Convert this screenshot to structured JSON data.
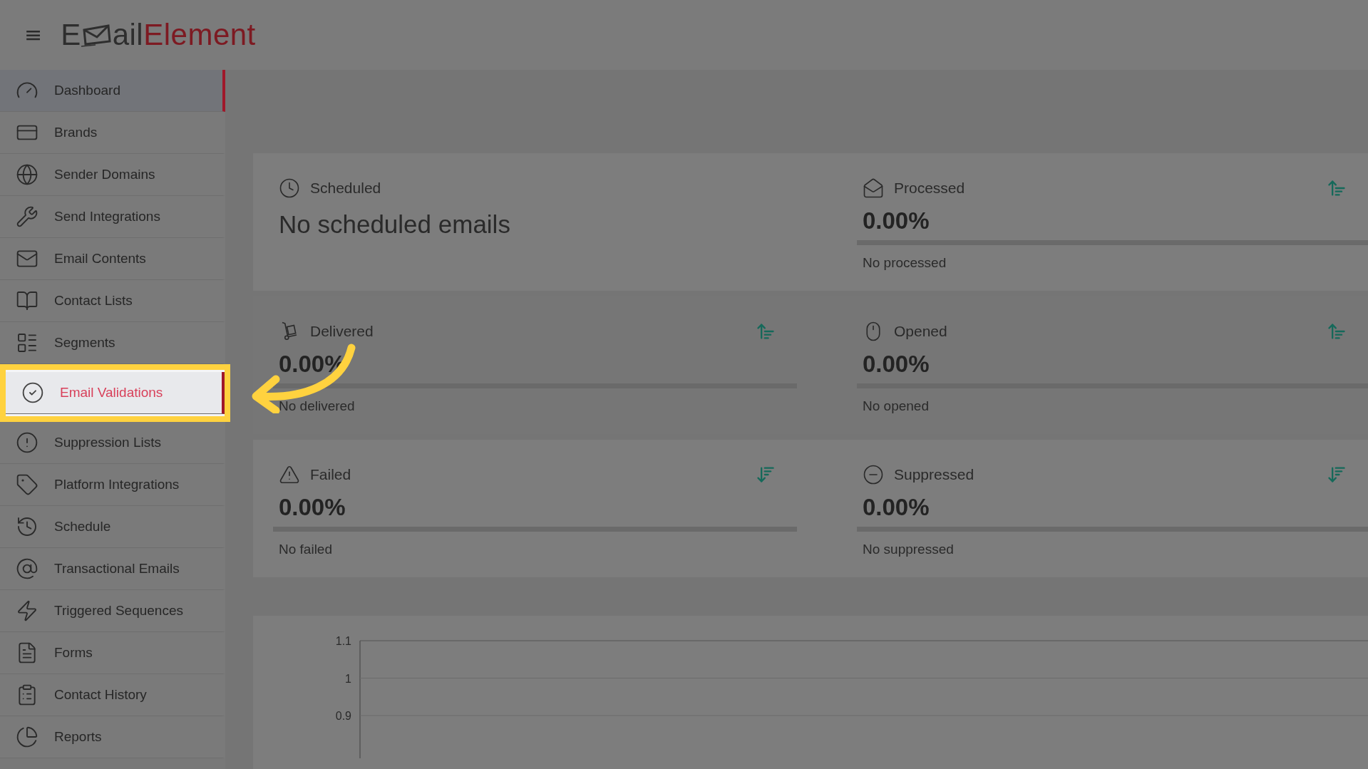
{
  "header": {
    "menu_icon": "≡",
    "logo": {
      "start": "E",
      "middle": "ail",
      "accent": "Element"
    }
  },
  "sidebar": {
    "items": [
      {
        "label": "Dashboard",
        "selected": true,
        "highlighted": false
      },
      {
        "label": "Brands",
        "selected": false,
        "highlighted": false
      },
      {
        "label": "Sender Domains",
        "selected": false,
        "highlighted": false
      },
      {
        "label": "Send Integrations",
        "selected": false,
        "highlighted": false
      },
      {
        "label": "Email Contents",
        "selected": false,
        "highlighted": false
      },
      {
        "label": "Contact Lists",
        "selected": false,
        "highlighted": false
      },
      {
        "label": "Segments",
        "selected": false,
        "highlighted": false
      },
      {
        "label": "Email Validations",
        "selected": true,
        "highlighted": true
      },
      {
        "label": "Suppression Lists",
        "selected": false,
        "highlighted": false
      },
      {
        "label": "Platform Integrations",
        "selected": false,
        "highlighted": false
      },
      {
        "label": "Schedule",
        "selected": false,
        "highlighted": false
      },
      {
        "label": "Transactional Emails",
        "selected": false,
        "highlighted": false
      },
      {
        "label": "Triggered Sequences",
        "selected": false,
        "highlighted": false
      },
      {
        "label": "Forms",
        "selected": false,
        "highlighted": false
      },
      {
        "label": "Contact History",
        "selected": false,
        "highlighted": false
      },
      {
        "label": "Reports",
        "selected": false,
        "highlighted": false
      }
    ]
  },
  "stats": [
    {
      "title": "Scheduled",
      "kind": "message",
      "value": "No scheduled emails"
    },
    {
      "title": "Processed",
      "kind": "meter",
      "value": "0.00%",
      "level": 0,
      "note": "No processed",
      "sort_descending": false
    },
    {
      "title": "Delivered",
      "kind": "meter",
      "value": "0.00%",
      "level": 0,
      "note": "No delivered",
      "sort_descending": false
    },
    {
      "title": "Opened",
      "kind": "meter",
      "value": "0.00%",
      "level": 0,
      "note": "No opened",
      "sort_descending": false
    },
    {
      "title": "Failed",
      "kind": "meter",
      "value": "0.00%",
      "level": 0,
      "note": "No failed",
      "sort_descending": true
    },
    {
      "title": "Suppressed",
      "kind": "meter",
      "value": "0.00%",
      "level": 0,
      "note": "No suppressed",
      "sort_descending": true
    }
  ],
  "chart": {
    "axis_labels": [
      "1.1",
      "1",
      "0.9"
    ]
  }
}
